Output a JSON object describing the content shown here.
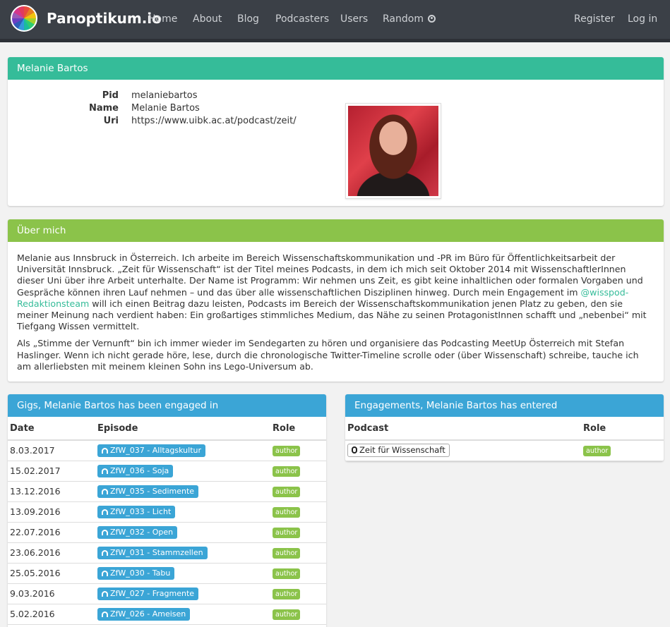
{
  "nav": {
    "brand": "Panoptikum.io",
    "links": [
      "Home",
      "About",
      "Blog",
      "Podcasters",
      "Users",
      "Random"
    ],
    "register": "Register",
    "login": "Log in"
  },
  "profile": {
    "title": "Melanie Bartos",
    "rows": [
      {
        "key": "Pid",
        "value": "melaniebartos"
      },
      {
        "key": "Name",
        "value": "Melanie Bartos"
      },
      {
        "key": "Uri",
        "value": "https://www.uibk.ac.at/podcast/zeit/"
      }
    ]
  },
  "about": {
    "title": "Über mich",
    "p1_before": "Melanie aus Innsbruck in Österreich. Ich arbeite im Bereich Wissenschaftskommunikation und -PR im Büro für Öffentlichkeitsarbeit der Universität Innsbruck. „Zeit für Wissenschaft“ ist der Titel meines Podcasts, in dem ich mich seit Oktober 2014 mit WissenschaftlerInnen dieser Uni über ihre Arbeit unterhalte. Der Name ist Programm: Wir nehmen uns Zeit, es gibt keine inhaltlichen oder formalen Vorgaben und Gespräche können ihren Lauf nehmen – und das über alle wissenschaftlichen Disziplinen hinweg. Durch mein Engagement im ",
    "p1_link": "@wisspod-Redaktionsteam",
    "p1_after": " will ich einen Beitrag dazu leisten, Podcasts im Bereich der Wissenschaftskommunikation jenen Platz zu geben, den sie meiner Meinung nach verdient haben: Ein großartiges stimmliches Medium, das Nähe zu seinen ProtagonistInnen schafft und „nebenbei“ mit Tiefgang Wissen vermittelt.",
    "p2": "Als „Stimme der Vernunft“ bin ich immer wieder im Sendegarten zu hören und organisiere das Podcasting MeetUp Österreich mit Stefan Haslinger. Wenn ich nicht gerade höre, lese, durch die chronologische Twitter-Timeline scrolle oder (über Wissenschaft) schreibe, tauche ich am allerliebsten mit meinem kleinen Sohn ins Lego-Universum ab."
  },
  "gigs": {
    "title": "Gigs, Melanie Bartos has been engaged in",
    "headers": [
      "Date",
      "Episode",
      "Role"
    ],
    "rows": [
      {
        "date": "8.03.2017",
        "episode": "ZfW_037 - Alltagskultur",
        "role": "author"
      },
      {
        "date": "15.02.2017",
        "episode": "ZfW_036 - Soja",
        "role": "author"
      },
      {
        "date": "13.12.2016",
        "episode": "ZfW_035 - Sedimente",
        "role": "author"
      },
      {
        "date": "13.09.2016",
        "episode": "ZfW_033 - Licht",
        "role": "author"
      },
      {
        "date": "22.07.2016",
        "episode": "ZfW_032 - Open",
        "role": "author"
      },
      {
        "date": "23.06.2016",
        "episode": "ZfW_031 - Stammzellen",
        "role": "author"
      },
      {
        "date": "25.05.2016",
        "episode": "ZfW_030 - Tabu",
        "role": "author"
      },
      {
        "date": "9.03.2016",
        "episode": "ZfW_027 - Fragmente",
        "role": "author"
      },
      {
        "date": "5.02.2016",
        "episode": "ZfW_026 - Ameisen",
        "role": "author"
      }
    ]
  },
  "engagements": {
    "title": "Engagements, Melanie Bartos has entered",
    "headers": [
      "Podcast",
      "Role"
    ],
    "rows": [
      {
        "podcast": "Zeit für Wissenschaft",
        "role": "author"
      }
    ]
  }
}
